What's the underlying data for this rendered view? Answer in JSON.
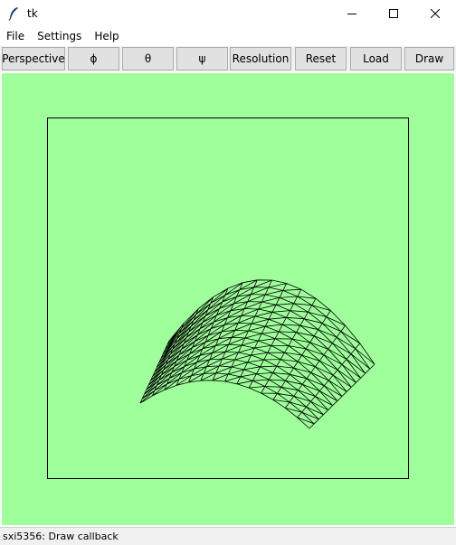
{
  "window": {
    "title": "tk"
  },
  "menu": [
    "File",
    "Settings",
    "Help"
  ],
  "toolbar": {
    "buttons": [
      "Perspective",
      "ϕ",
      "θ",
      "ψ",
      "Resolution",
      "Reset",
      "Load",
      "Draw"
    ]
  },
  "canvas": {
    "background": "#9eff9b"
  },
  "status": {
    "text": "sxi5356: Draw callback"
  }
}
